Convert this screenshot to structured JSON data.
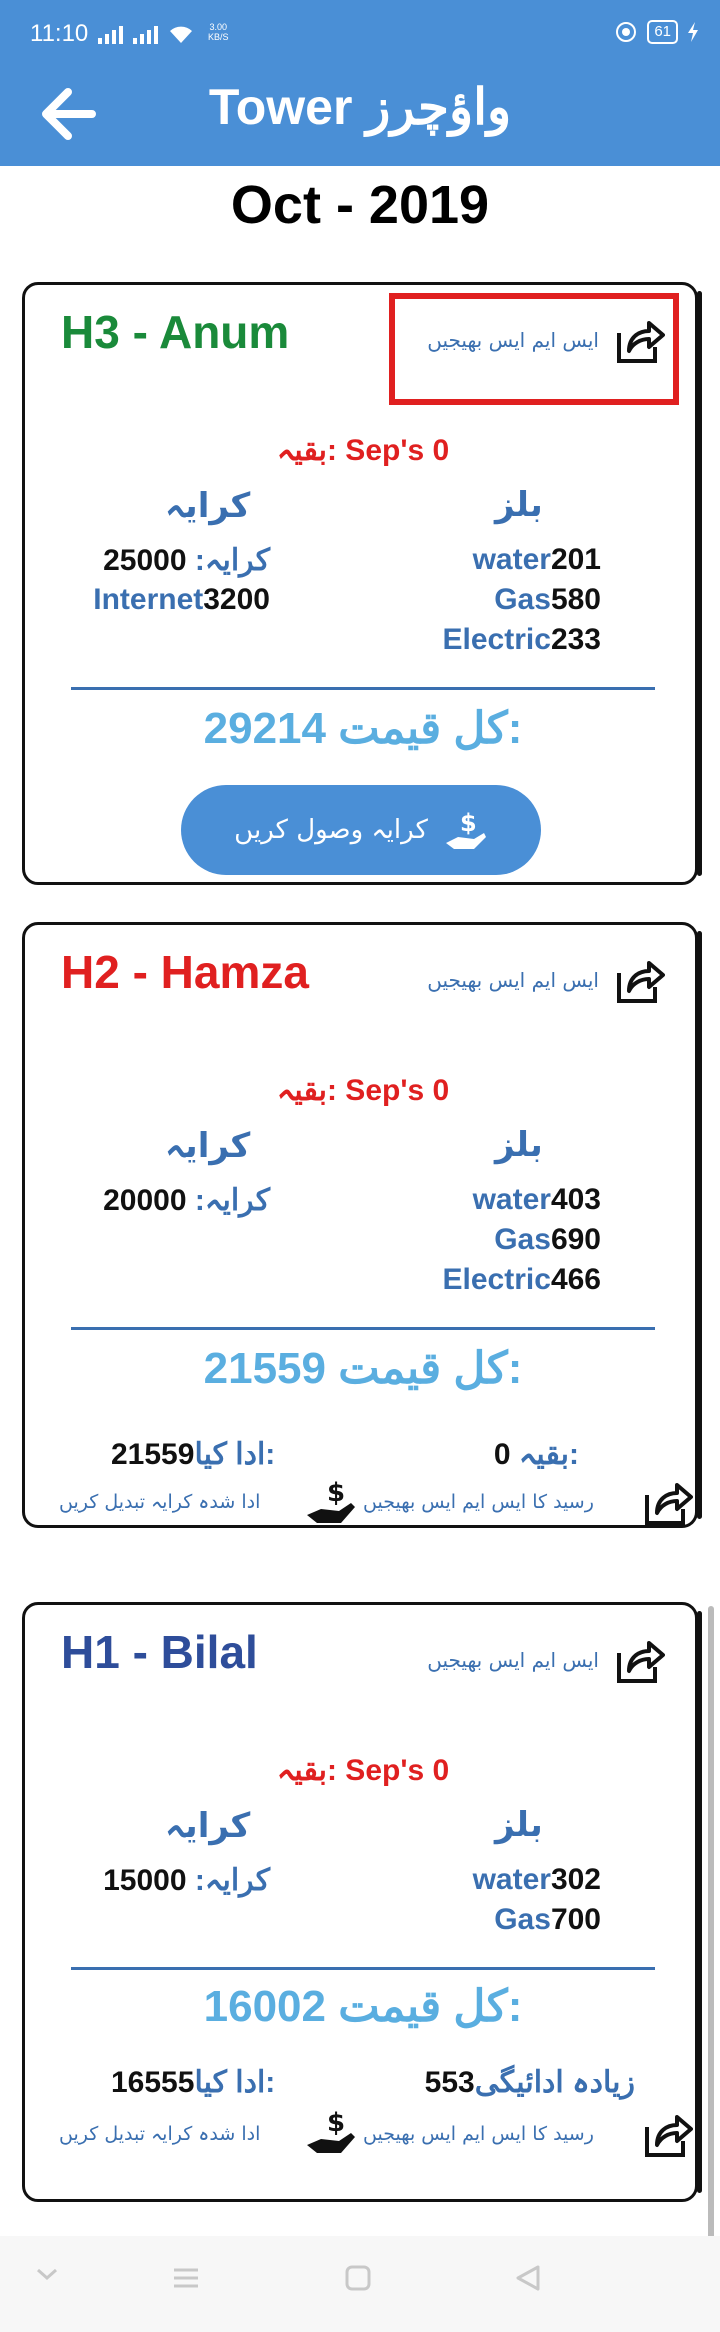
{
  "status_bar": {
    "time": "11:10",
    "speed_value": "3.00",
    "speed_unit": "KB/S",
    "battery": "61"
  },
  "app_bar": {
    "title": "Tower واؤچرز",
    "back_icon": "arrow-left-icon"
  },
  "month": "Oct - 2019",
  "cards": [
    {
      "name": "H3 - Anum",
      "name_color": "#1a8a3a",
      "sms_label": "ایس ایم ایس بھیجیں",
      "remaining": "بقیہ: Sep's 0",
      "bills_title": "بلز",
      "rent_title": "کرایہ",
      "bills": [
        {
          "label": "water",
          "value": "201"
        },
        {
          "label": "Gas",
          "value": "580"
        },
        {
          "label": "Electric",
          "value": "233"
        }
      ],
      "rent": [
        {
          "label": "کرایہ:",
          "value": "25000"
        },
        {
          "label": "Internet",
          "value": "3200"
        }
      ],
      "total_label": "کل قیمت:",
      "total_value": "29214",
      "collect_button": "کرایہ وصول کریں"
    },
    {
      "name": "H2 - Hamza",
      "name_color": "#e02020",
      "sms_label": "ایس ایم ایس بھیجیں",
      "remaining": "بقیہ: Sep's 0",
      "bills_title": "بلز",
      "rent_title": "کرایہ",
      "bills": [
        {
          "label": "water",
          "value": "403"
        },
        {
          "label": "Gas",
          "value": "690"
        },
        {
          "label": "Electric",
          "value": "466"
        }
      ],
      "rent": [
        {
          "label": "کرایہ:",
          "value": "20000"
        }
      ],
      "total_label": "کل قیمت:",
      "total_value": "21559",
      "balance_label": "بقیہ:",
      "balance_value": "0",
      "paid_label": "ادا کیا:",
      "paid_value": "21559",
      "receipt_sms": "رسید کا ایس ایم ایس بھیجیں",
      "change_paid": "ادا شدہ کرایہ تبدیل کریں"
    },
    {
      "name": "H1 - Bilal",
      "name_color": "#2e4d9a",
      "sms_label": "ایس ایم ایس بھیجیں",
      "remaining": "بقیہ: Sep's 0",
      "bills_title": "بلز",
      "rent_title": "کرایہ",
      "bills": [
        {
          "label": "water",
          "value": "302"
        },
        {
          "label": "Gas",
          "value": "700"
        }
      ],
      "rent": [
        {
          "label": "کرایہ:",
          "value": "15000"
        }
      ],
      "total_label": "کل قیمت:",
      "total_value": "16002",
      "balance_label": "زیادہ ادائیگی",
      "balance_value": "553",
      "paid_label": "ادا کیا:",
      "paid_value": "16555",
      "receipt_sms": "رسید کا ایس ایم ایس بھیجیں",
      "change_paid": "ادا شدہ کرایہ تبدیل کریں"
    }
  ],
  "nav": {
    "icons": [
      "chevron-down-icon",
      "menu-icon",
      "home-square-icon",
      "back-triangle-icon"
    ]
  }
}
